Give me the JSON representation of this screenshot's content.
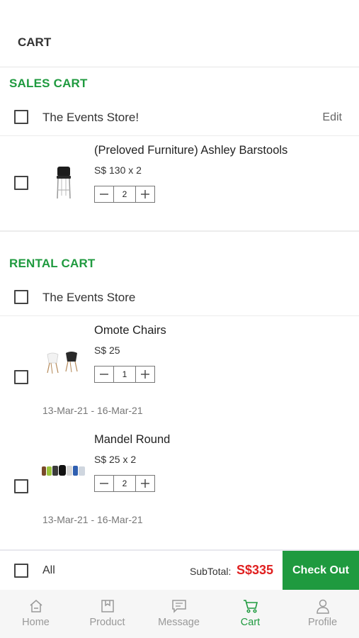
{
  "header": {
    "title": "CART"
  },
  "sales_cart": {
    "title": "SALES CART",
    "store": {
      "name": "The Events Store!",
      "edit_label": "Edit"
    },
    "items": [
      {
        "name": "(Preloved Furniture) Ashley Barstools",
        "price": "S$ 130  x 2",
        "qty": "2"
      }
    ]
  },
  "rental_cart": {
    "title": "RENTAL CART",
    "store": {
      "name": "The Events Store"
    },
    "items": [
      {
        "name": "Omote Chairs",
        "price": "S$ 25",
        "qty": "1",
        "dates": "13-Mar-21 - 16-Mar-21"
      },
      {
        "name": "Mandel Round",
        "price": "S$ 25  x 2",
        "qty": "2",
        "dates": "13-Mar-21 - 16-Mar-21"
      }
    ]
  },
  "bottom_bar": {
    "all_label": "All",
    "subtotal_label": "SubTotal:",
    "subtotal_value": "S$335",
    "checkout_label": "Check Out"
  },
  "tabbar": {
    "tabs": [
      {
        "label": "Home",
        "icon": "home-icon"
      },
      {
        "label": "Product",
        "icon": "product-icon"
      },
      {
        "label": "Message",
        "icon": "message-icon"
      },
      {
        "label": "Cart",
        "icon": "cart-icon",
        "active": true
      },
      {
        "label": "Profile",
        "icon": "profile-icon"
      }
    ]
  },
  "colors": {
    "accent": "#1f9a3f",
    "price_red": "#e02020"
  }
}
